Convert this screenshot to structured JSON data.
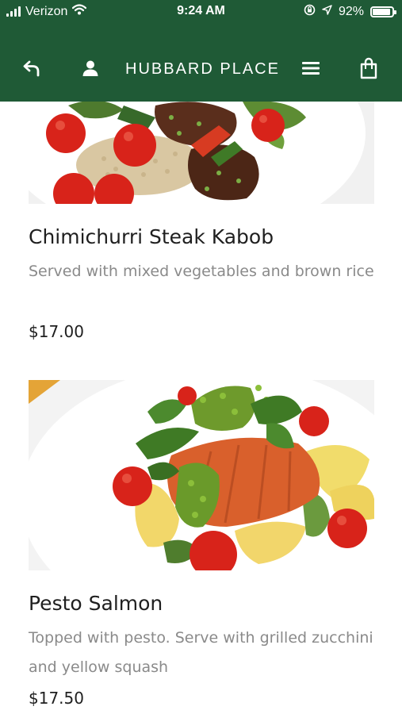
{
  "status_bar": {
    "carrier": "Verizon",
    "time": "9:24 AM",
    "battery": "92%"
  },
  "nav": {
    "title": "HUBBARD PLACE",
    "icons": [
      "back-arrow-icon",
      "user-icon",
      "menu-icon",
      "shopping-bag-icon"
    ]
  },
  "menu_items": [
    {
      "name": "Chimichurri Steak Kabob",
      "description": "Served with mixed vegetables and brown rice",
      "price": "$17.00"
    },
    {
      "name": "Pesto Salmon",
      "description": "Topped with pesto. Serve with grilled zucchini and yellow squash",
      "price": "$17.50"
    }
  ],
  "colors": {
    "header_bg": "#1f5a36",
    "header_text": "#ffffff",
    "description_text": "#8a8a8a"
  }
}
